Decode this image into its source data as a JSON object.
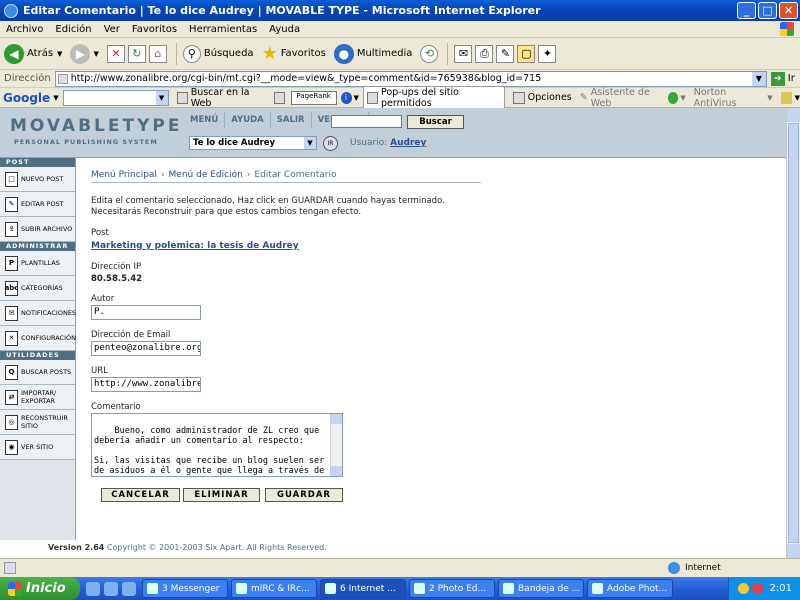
{
  "window": {
    "title": "Editar Comentario | Te lo dice Audrey | MOVABLE TYPE - Microsoft Internet Explorer",
    "min": "_",
    "max": "□",
    "close": "✕"
  },
  "menu": [
    "Archivo",
    "Edición",
    "Ver",
    "Favoritos",
    "Herramientas",
    "Ayuda"
  ],
  "toolbar": {
    "back": "Atrás",
    "search": "Búsqueda",
    "favorites": "Favoritos",
    "media": "Multimedia"
  },
  "address": {
    "label": "Dirección",
    "url": "http://www.zonalibre.org/cgi-bin/mt.cgi?__mode=view&_type=comment&id=765938&blog_id=715",
    "go": "Ir"
  },
  "google_bar": {
    "logo": "Google",
    "search_web": "Buscar en la Web",
    "pagerank": "PageRank",
    "popups": "Pop-ups del sitio permitidos",
    "options": "Opciones",
    "site_assistant": "Asistente de Web",
    "antivirus": "Norton AntiVirus"
  },
  "mt": {
    "logo": "MOVABLETYPE",
    "tagline": "PERSONAL PUBLISHING SYSTEM",
    "nav": [
      "MENÚ",
      "AYUDA",
      "SALIR",
      "VERSITIO"
    ],
    "search_button": "Buscar",
    "blog_select": "Te lo dice Audrey",
    "go_label": "IR",
    "user_label": "Usuario:",
    "user_name": "Audrey"
  },
  "sidebar": {
    "post_header": "POST",
    "admin_header": "ADMINISTRAR",
    "util_header": "UTILIDADES",
    "items": [
      {
        "label": "NUEVO POST",
        "icon": "□"
      },
      {
        "label": "EDITAR POST",
        "icon": "✎"
      },
      {
        "label": "SUBIR ARCHIVO",
        "icon": "⇪"
      },
      {
        "label": "PLANTILLAS",
        "icon": "P"
      },
      {
        "label": "CATEGORÍAS",
        "icon": "abc"
      },
      {
        "label": "NOTIFICACIONES",
        "icon": "✉"
      },
      {
        "label": "CONFIGURACIÓN",
        "icon": "✕"
      },
      {
        "label": "BUSCAR POSTS",
        "icon": "Q"
      },
      {
        "label": "IMPORTAR/ EXPORTAR",
        "icon": "⇄"
      },
      {
        "label": "RECONSTRUIR SITIO",
        "icon": "◎"
      },
      {
        "label": "VER SITIO",
        "icon": "◉"
      }
    ]
  },
  "breadcrumb": {
    "home": "Menú Principal",
    "edit_menu": "Menú de Edición",
    "current": "Editar Comentario",
    "sep": "›"
  },
  "form": {
    "intro": "Edita el comentario seleccionado, Haz click en GUARDAR cuando hayas terminado. Necesitarás Reconstruir para que estos cambios tengan efecto.",
    "post_label": "Post",
    "post_link": "Marketing y polemica: la tesis de Audrey",
    "ip_label": "Dirección IP",
    "ip_value": "80.58.5.42",
    "author_label": "Autor",
    "author_value": "P.",
    "email_label": "Dirección de Email",
    "email_value": "penteo@zonalibre.org",
    "url_label": "URL",
    "url_value": "http://www.zonalibre",
    "comment_label": "Comentario",
    "comment_value": "Bueno, como administrador de ZL creo que debería añadir un comentario al respecto:\n\nSi, las visitas que recibe un blog suelen ser de asiduos a él o gente que llega a través de los links de otros weblogs.",
    "cancel": "CANCELAR",
    "delete": "ELIMINAR",
    "save": "GUARDAR"
  },
  "footer": {
    "version": "Version 2.64",
    "copyright": "Copyright © 2001-2003 Six Apart. All Rights Reserved."
  },
  "status": {
    "zone": "Internet"
  },
  "taskbar": {
    "start": "Inicio",
    "tasks": [
      "3 Messenger",
      "mIRC & IRc...",
      "6 Internet ...",
      "2 Photo Ed...",
      "Bandeja de ...",
      "Adobe Phot..."
    ],
    "clock": "2:01"
  }
}
